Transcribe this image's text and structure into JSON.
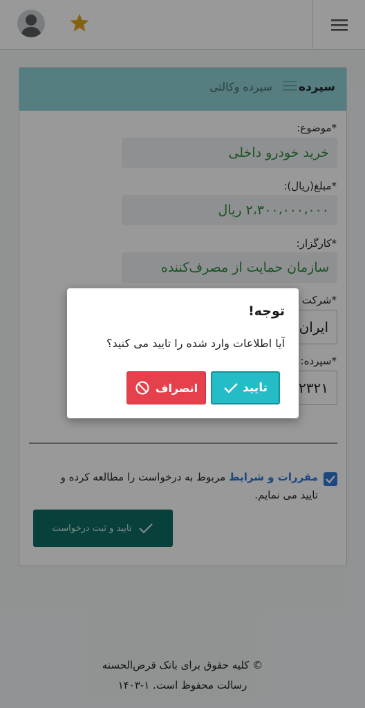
{
  "header": {
    "avatar_icon": "user-avatar-icon",
    "star_icon": "star-icon",
    "star_color": "#e0a21c",
    "menu_icon": "hamburger-menu-icon"
  },
  "card": {
    "title": "سپرده",
    "subtitle": "سپرده وکالتی",
    "header_color": "#8fd0d6",
    "fields": [
      {
        "label": "*موضوع:",
        "value": "خرید خودرو داخلی"
      },
      {
        "label": "*مبلغ(ریال):",
        "value": "۲،۳۰۰،۰۰۰،۰۰۰ ریال"
      },
      {
        "label": "*کارگزار:",
        "value": "سازمان حمایت از مصرف‌کننده"
      },
      {
        "label": "*شرکت",
        "value": "ایران"
      },
      {
        "label": "*سپرده:",
        "value": "۲۳۲۱"
      }
    ],
    "terms_checked": true,
    "terms_link": "مقررات و شرایط",
    "terms_text": " مربوط به درخواست را مطالعه کرده و تایید می نمایم.",
    "submit_label": "تایید و ثبت درخواست"
  },
  "footer": {
    "line1": "© کلیه حقوق برای بانک قرض‌الحسنه",
    "line2": "رسالت محفوظ است. ۱-۱۴۰۳"
  },
  "modal": {
    "title": "توجه!",
    "message": "آیا اطلاعات وارد شده را تایید می کنید؟",
    "confirm_label": "تایید",
    "cancel_label": "انصراف",
    "confirm_color": "#24bcc6",
    "cancel_color": "#e5404b"
  }
}
